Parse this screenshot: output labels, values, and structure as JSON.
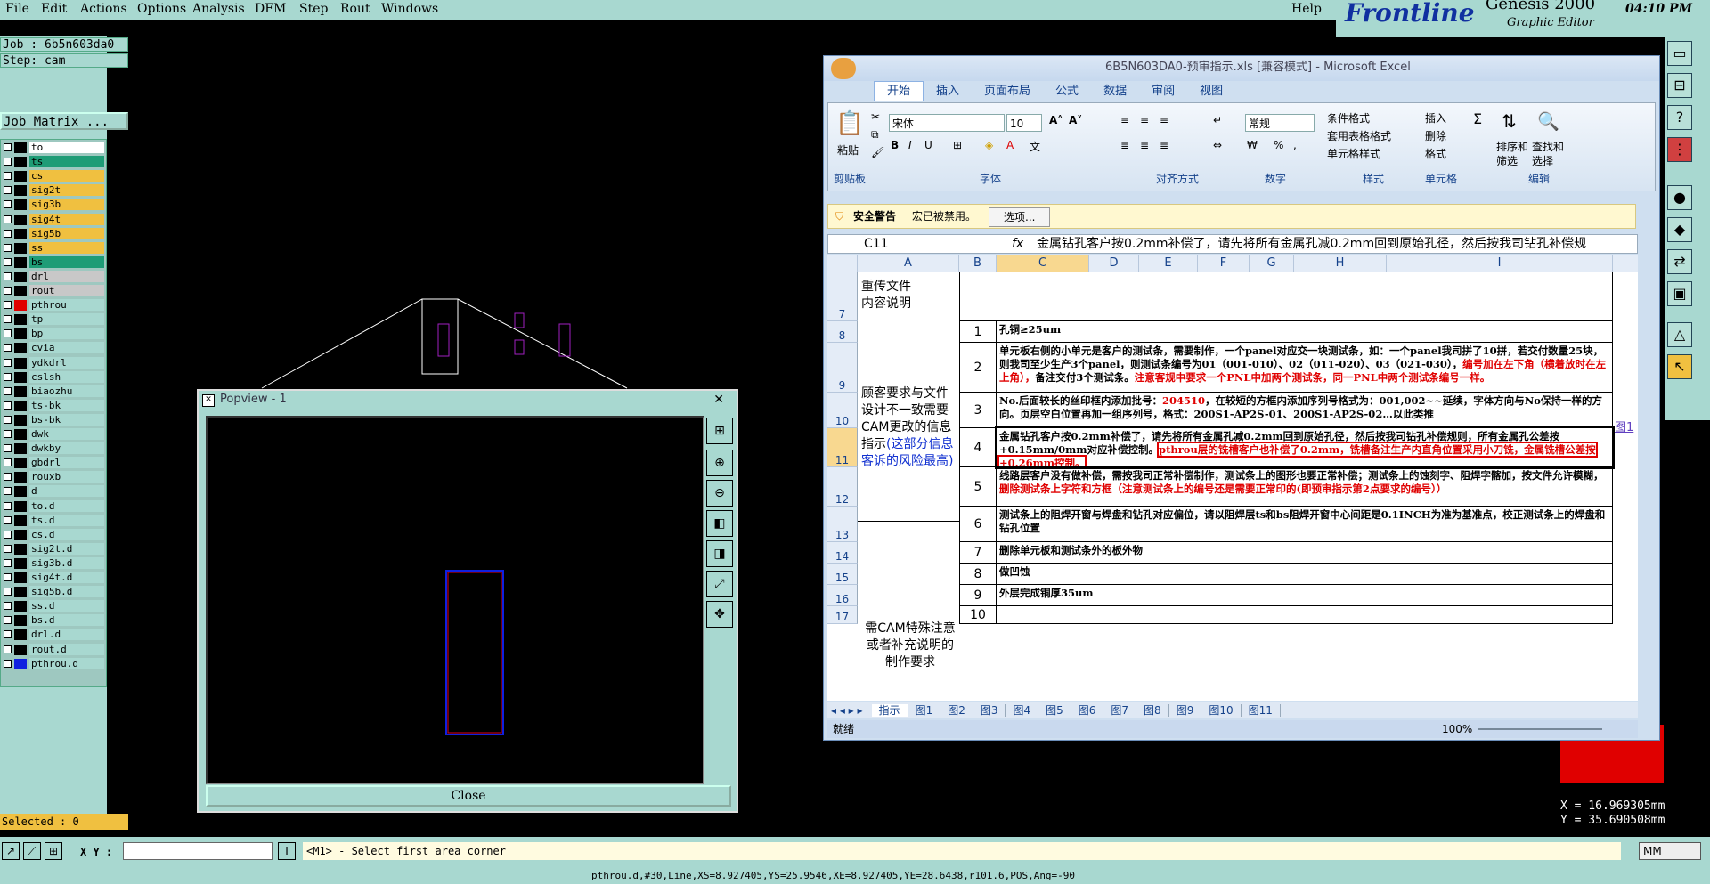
{
  "menu": [
    "File",
    "Edit",
    "Actions",
    "Options",
    "Analysis",
    "DFM",
    "Step",
    "Rout",
    "Windows"
  ],
  "help_label": "Help",
  "brand": {
    "logo": "Frontline",
    "product": "Genesis 2000",
    "subtitle": "Graphic Editor",
    "clock": "04:10 PM"
  },
  "job": {
    "job": "Job : 6b5n603da0",
    "step": "Step: cam",
    "matrix": "Job Matrix ..."
  },
  "layers": [
    {
      "name": "to",
      "color": "#ffffff",
      "sw": "#000000"
    },
    {
      "name": "ts",
      "color": "#1e9c76",
      "sw": "#000000"
    },
    {
      "name": "cs",
      "color": "#f0c040",
      "sw": "#000000"
    },
    {
      "name": "sig2t",
      "color": "#f0c040",
      "sw": "#000000"
    },
    {
      "name": "sig3b",
      "color": "#f0c040",
      "sw": "#000000"
    },
    {
      "name": "sig4t",
      "color": "#f0c040",
      "sw": "#000000"
    },
    {
      "name": "sig5b",
      "color": "#f0c040",
      "sw": "#000000"
    },
    {
      "name": "ss",
      "color": "#f0c040",
      "sw": "#000000"
    },
    {
      "name": "bs",
      "color": "#1e9c76",
      "sw": "#000000"
    },
    {
      "name": "drl",
      "color": "#c8c8c8",
      "sw": "#000000"
    },
    {
      "name": "rout",
      "color": "#c8c8c8",
      "sw": "#000000"
    },
    {
      "name": "pthrou",
      "color": "#a8d8d0",
      "sw": "#e00000"
    },
    {
      "name": "tp",
      "color": "#a8d8d0",
      "sw": "#000000"
    },
    {
      "name": "bp",
      "color": "#a8d8d0",
      "sw": "#000000"
    },
    {
      "name": "cvia",
      "color": "#a8d8d0",
      "sw": "#000000"
    },
    {
      "name": "ydkdrl",
      "color": "#a8d8d0",
      "sw": "#000000"
    },
    {
      "name": "cslsh",
      "color": "#a8d8d0",
      "sw": "#000000"
    },
    {
      "name": "biaozhu",
      "color": "#a8d8d0",
      "sw": "#000000"
    },
    {
      "name": "ts-bk",
      "color": "#a8d8d0",
      "sw": "#000000"
    },
    {
      "name": "bs-bk",
      "color": "#a8d8d0",
      "sw": "#000000"
    },
    {
      "name": "dwk",
      "color": "#a8d8d0",
      "sw": "#000000"
    },
    {
      "name": "dwkby",
      "color": "#a8d8d0",
      "sw": "#000000"
    },
    {
      "name": "gbdrl",
      "color": "#a8d8d0",
      "sw": "#000000"
    },
    {
      "name": "rouxb",
      "color": "#a8d8d0",
      "sw": "#000000"
    },
    {
      "name": "d",
      "color": "#a8d8d0",
      "sw": "#000000"
    },
    {
      "name": "to.d",
      "color": "#a8d8d0",
      "sw": "#000000"
    },
    {
      "name": "ts.d",
      "color": "#a8d8d0",
      "sw": "#000000"
    },
    {
      "name": "cs.d",
      "color": "#a8d8d0",
      "sw": "#000000"
    },
    {
      "name": "sig2t.d",
      "color": "#a8d8d0",
      "sw": "#000000"
    },
    {
      "name": "sig3b.d",
      "color": "#a8d8d0",
      "sw": "#000000"
    },
    {
      "name": "sig4t.d",
      "color": "#a8d8d0",
      "sw": "#000000"
    },
    {
      "name": "sig5b.d",
      "color": "#a8d8d0",
      "sw": "#000000"
    },
    {
      "name": "ss.d",
      "color": "#a8d8d0",
      "sw": "#000000"
    },
    {
      "name": "bs.d",
      "color": "#a8d8d0",
      "sw": "#000000"
    },
    {
      "name": "drl.d",
      "color": "#a8d8d0",
      "sw": "#000000"
    },
    {
      "name": "rout.d",
      "color": "#a8d8d0",
      "sw": "#000000"
    },
    {
      "name": "pthrou.d",
      "color": "#a8d8d0",
      "sw": "#1020e0"
    }
  ],
  "selected": "Selected : 0",
  "xy_label": "X Y :",
  "prompt": "<M1> - Select first area corner",
  "status": "pthrou.d,#30,Line,XS=8.927405,YS=25.9546,XE=8.927405,YE=28.6438,r101.6,POS,Ang=-90",
  "units": "MM",
  "coords": {
    "x": "X = 16.969305mm",
    "y": "Y = 35.690508mm"
  },
  "popview": {
    "title": "Popview - 1",
    "close": "Close"
  },
  "excel": {
    "title": "6B5N603DA0-预审指示.xls  [兼容模式] - Microsoft Excel",
    "tabs": [
      "开始",
      "插入",
      "页面布局",
      "公式",
      "数据",
      "审阅",
      "视图"
    ],
    "paste": "粘贴",
    "font_name": "宋体",
    "font_size": "10",
    "number_format": "常规",
    "groups": [
      "剪贴板",
      "字体",
      "对齐方式",
      "数字",
      "样式",
      "单元格",
      "编辑"
    ],
    "styles": [
      "条件格式",
      "套用表格格式",
      "单元格样式"
    ],
    "cells_btns": [
      "插入",
      "删除",
      "格式"
    ],
    "edit_btns": [
      "排序和",
      "筛选",
      "查找和",
      "选择"
    ],
    "security_title": "安全警告",
    "security_msg": "宏已被禁用。",
    "options_btn": "选项...",
    "namebox": "C11",
    "formula": "金属钻孔客户按0.2mm补偿了，请先将所有金属孔减0.2mm回到原始孔径，然后按我司钻孔补偿规",
    "columns": [
      "A",
      "B",
      "C",
      "D",
      "E",
      "F",
      "G",
      "H",
      "I"
    ],
    "rows": [
      {
        "rn": "7",
        "a": "重传文件\n内容说明",
        "b": "",
        "i": ""
      },
      {
        "rn": "8",
        "a": "",
        "b": "1",
        "i": "孔铜≥25um"
      },
      {
        "rn": "9",
        "a": "",
        "b": "2",
        "i": "单元板右侧的小单元是客户的测试条，需要制作，一个panel对应交一块测试条，如：一个panel我司拼了10拼，若交付数量25块，则我司至少生产3个panel，则测试条编号为01（001-010）、02（011-020）、03（021-030），",
        "ired": "编号加在左下角（横着放时在左上角），",
        "i2": "备注交付3个测试条。",
        "ired2": "注意客规中要求一个PNL中加两个测试条，同一PNL中两个测试条编号一样。"
      },
      {
        "rn": "10",
        "a": "",
        "b": "3",
        "i": "No.后面较长的丝印框内添加批号：",
        "ired": "204510",
        "i2": "，在较短的方框内添加序列号格式为：001,002~~延续，字体方向与No保持一样的方向。页层空白位置再加一组序列号，格式：200S1-AP2S-01、200S1-AP2S-02…以此类推"
      },
      {
        "rn": "11",
        "a": "",
        "b": "4",
        "i": "金属钻孔客户按0.2mm补偿了，请先将所有金属孔减0.2mm回到原始孔径，然后按我司钻孔补偿规则，所有金属孔公差按+0.15mm/0mm对应补偿控制。",
        "ired": "pthrou层的铣槽客户也补偿了0.2mm，铣槽备注生产内直角位置采用小刀铣，金属铣槽公差按+0.26mm控制。"
      },
      {
        "rn": "12",
        "a": "",
        "b": "5",
        "i": "线路层客户没有做补偿，需按我司正常补偿制作，测试条上的图形也要正常补偿；测试条上的蚀刻字、阻焊字髂加，按文件允许模糊，",
        "ired": "删除测试条上字符和方框（注意测试条上的编号还是需要正常印的(即预审指示第2点要求的编号））"
      },
      {
        "rn": "13",
        "a": "",
        "b": "6",
        "i": "测试条上的阻焊开窗与焊盘和钻孔对应偏位，请以阻焊层ts和bs阻焊开窗中心间距是0.1INCH为准为基准点，校正测试条上的焊盘和钻孔位置"
      },
      {
        "rn": "14",
        "a": "",
        "b": "7",
        "i": "删除单元板和测试条外的板外物"
      },
      {
        "rn": "15",
        "a": "",
        "b": "8",
        "i": "做凹蚀"
      },
      {
        "rn": "16",
        "a": "",
        "b": "9",
        "i": "外层完成铜厚35um"
      },
      {
        "rn": "17",
        "a": "",
        "b": "10",
        "i": ""
      }
    ],
    "a_block1": "顾客要求与文件设计不一致需要CAM更改的信息指示",
    "a_block1_blue": "(这部分信息客诉的风险最高)",
    "a_block2": "需CAM特殊注意或者补充说明的制作要求",
    "side_link": "图1",
    "sheets": [
      "指示",
      "图1",
      "图2",
      "图3",
      "图4",
      "图5",
      "图6",
      "图7",
      "图8",
      "图9",
      "图10",
      "图11"
    ],
    "ready": "就绪",
    "zoom": "100%"
  }
}
